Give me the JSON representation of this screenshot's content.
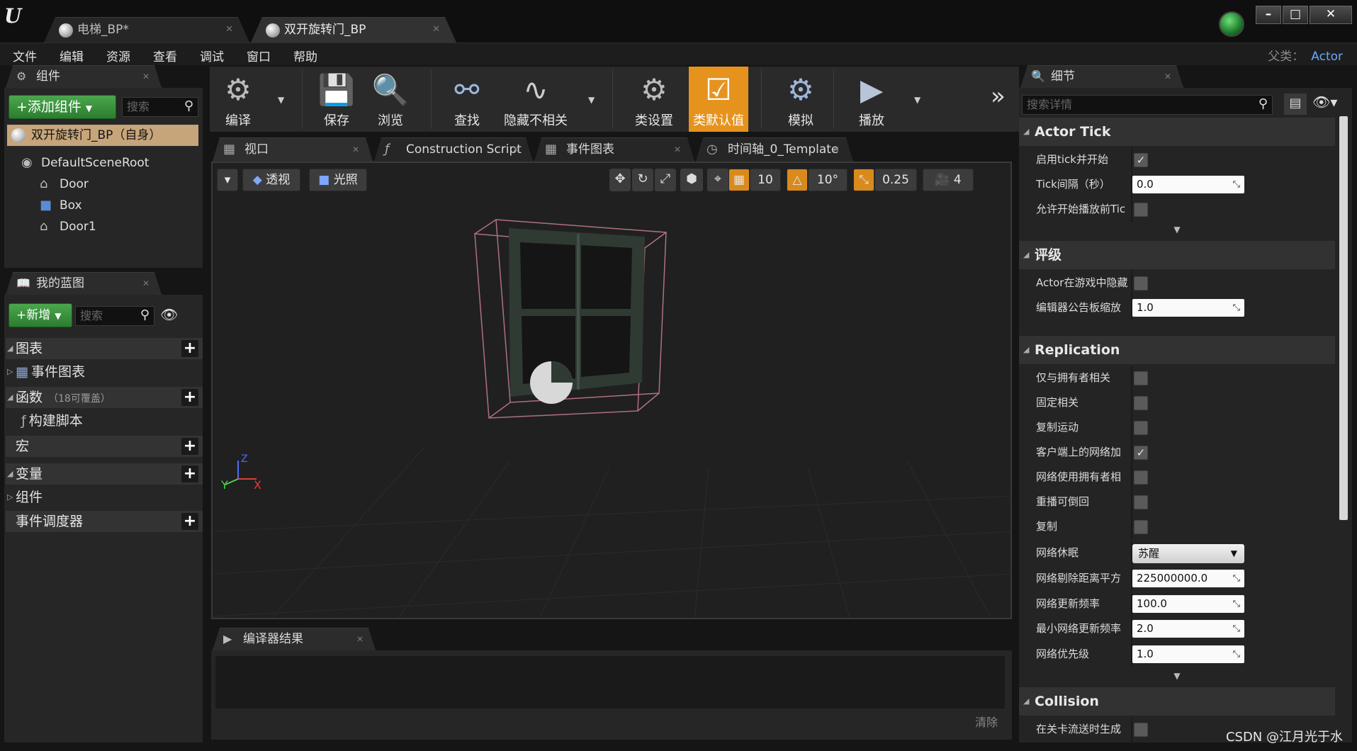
{
  "titlebar": {
    "tabs": [
      {
        "label": "电梯_BP*"
      },
      {
        "label": "双开旋转门_BP"
      }
    ],
    "window_buttons": [
      "–",
      "□",
      "✕"
    ]
  },
  "menubar": {
    "items": [
      "文件",
      "编辑",
      "资源",
      "查看",
      "调试",
      "窗口",
      "帮助"
    ],
    "parent_label": "父类：",
    "parent_class": "Actor"
  },
  "components": {
    "tab_title": "组件",
    "add_button": "+添加组件",
    "search_placeholder": "搜索",
    "self_item": "双开旋转门_BP（自身）",
    "tree": [
      {
        "label": "DefaultSceneRoot",
        "icon": "scene-root-icon"
      },
      {
        "label": "Door",
        "icon": "static-mesh-icon"
      },
      {
        "label": "Box",
        "icon": "box-collision-icon"
      },
      {
        "label": "Door1",
        "icon": "static-mesh-icon"
      }
    ]
  },
  "my_blueprint": {
    "tab_title": "我的蓝图",
    "new_button": "+新增",
    "search_placeholder": "搜索",
    "graphs_label": "图表",
    "event_graph": "事件图表",
    "functions_label": "函数",
    "functions_override": "（18可覆盖）",
    "construction_script": "构建脚本",
    "macros_label": "宏",
    "variables_label": "变量",
    "components_label": "组件",
    "dispatchers_label": "事件调度器"
  },
  "toolbar": {
    "compile": "编译",
    "save": "保存",
    "browse": "浏览",
    "find": "查找",
    "hide_unrelated": "隐藏不相关",
    "class_settings": "类设置",
    "class_defaults": "类默认值",
    "simulate": "模拟",
    "play": "播放"
  },
  "editor_tabs": [
    {
      "label": "视口"
    },
    {
      "label": "Construction Script"
    },
    {
      "label": "事件图表"
    },
    {
      "label": "时间轴_0_Template"
    }
  ],
  "viewport": {
    "perspective": "透视",
    "lit": "光照",
    "grid_snap": "10",
    "rotation_snap": "10°",
    "scale_snap": "0.25",
    "camera_speed": "4",
    "axis_x": "X",
    "axis_y": "Y",
    "axis_z": "Z"
  },
  "compiler": {
    "tab_title": "编译器结果",
    "clear": "清除"
  },
  "details": {
    "tab_title": "细节",
    "search_placeholder": "搜索详情",
    "sections": {
      "actor_tick": "Actor Tick",
      "rendering": "评级",
      "replication": "Replication",
      "collision": "Collision"
    },
    "props": {
      "start_with_tick": "启用tick并开始",
      "tick_interval": "Tick间隔（秒）",
      "tick_interval_value": "0.0",
      "tick_before_begin": "允许开始播放前Tic",
      "hidden_in_game": "Actor在游戏中隐藏",
      "billboard_scale": "编辑器公告板缩放",
      "billboard_scale_value": "1.0",
      "only_owner_relevant": "仅与拥有者相关",
      "always_relevant": "固定相关",
      "replicate_movement": "复制运动",
      "net_load_on_client": "客户端上的网络加",
      "net_use_owner_relevancy": "网络使用拥有者相",
      "replay_rewindable": "重播可倒回",
      "replicates": "复制",
      "net_dormancy": "网络休眠",
      "net_dormancy_value": "苏醒",
      "net_cull_distance": "网络剔除距离平方",
      "net_cull_distance_value": "225000000.0",
      "net_update_freq": "网络更新频率",
      "net_update_freq_value": "100.0",
      "min_net_update_freq": "最小网络更新频率",
      "min_net_update_freq_value": "2.0",
      "net_priority": "网络优先级",
      "net_priority_value": "1.0",
      "gen_overlap_on_stream": "在关卡流送时生成"
    }
  },
  "watermark": "CSDN @江月光于水",
  "colors": {
    "accent_orange": "#e6931e",
    "add_green": "#3a953d",
    "self_row": "#c7a57b",
    "parent_class": "#67a8ff"
  }
}
